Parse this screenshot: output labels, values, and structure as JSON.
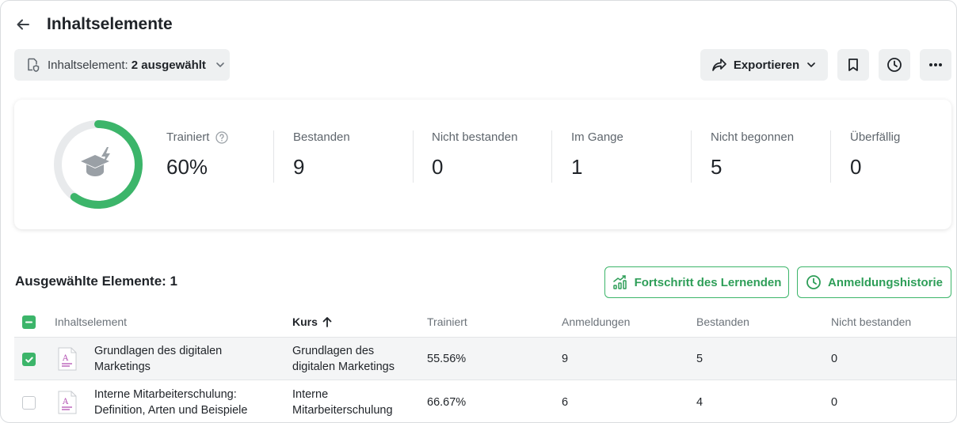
{
  "header": {
    "title": "Inhaltselemente"
  },
  "filter": {
    "label": "Inhaltselement:",
    "value": "2 ausgewählt"
  },
  "toolbar": {
    "export_label": "Exportieren"
  },
  "stats": {
    "progress_fraction": 0.6,
    "items": [
      {
        "label": "Trainiert",
        "value": "60%"
      },
      {
        "label": "Bestanden",
        "value": "9"
      },
      {
        "label": "Nicht bestanden",
        "value": "0"
      },
      {
        "label": "Im Gange",
        "value": "1"
      },
      {
        "label": "Nicht begonnen",
        "value": "5"
      },
      {
        "label": "Überfällig",
        "value": "0"
      }
    ]
  },
  "selection": {
    "title": "Ausgewählte Elemente: 1",
    "progress_button": "Fortschritt des Lernenden",
    "history_button": "Anmeldungshistorie"
  },
  "table": {
    "columns": [
      "Inhaltselement",
      "Kurs",
      "Trainiert",
      "Anmeldungen",
      "Bestanden",
      "Nicht bestanden"
    ],
    "rows": [
      {
        "checked": true,
        "item_line1": "Grundlagen des digitalen",
        "item_line2": "Marketings",
        "course_line1": "Grundlagen des",
        "course_line2": "digitalen Marketings",
        "trained": "55.56%",
        "enrollments": "9",
        "passed": "5",
        "failed": "0"
      },
      {
        "checked": false,
        "item_line1": "Interne Mitarbeiterschulung:",
        "item_line2": "Definition, Arten und Beispiele",
        "course_line1": "Interne",
        "course_line2": "Mitarbeiterschulung",
        "trained": "66.67%",
        "enrollments": "6",
        "passed": "4",
        "failed": "0"
      }
    ]
  },
  "colors": {
    "accent": "#3cb56a",
    "ring_track": "#e8eaec",
    "icon_gray": "#9aa0a6"
  }
}
